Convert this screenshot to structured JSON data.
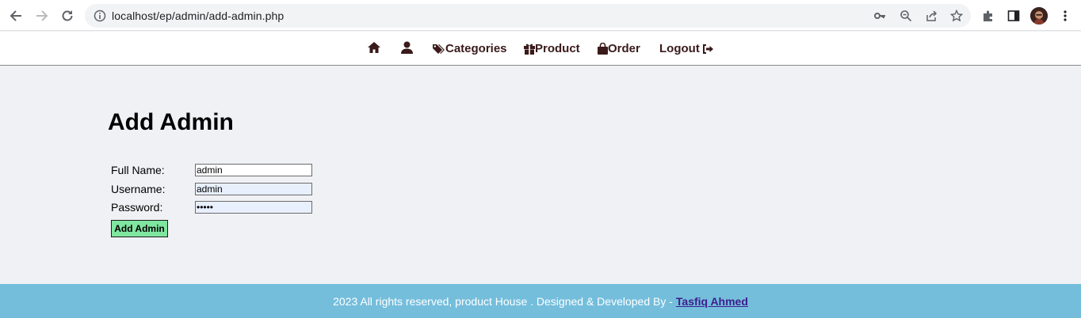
{
  "browser": {
    "url": "localhost/ep/admin/add-admin.php"
  },
  "nav": {
    "home_icon": "home-icon",
    "profile_icon": "user-icon",
    "categories": "Categories",
    "product": "Product",
    "order": "Order",
    "logout": "Logout"
  },
  "main": {
    "title": "Add Admin",
    "form": {
      "full_name_label": "Full Name:",
      "full_name_value": "admin",
      "username_label": "Username:",
      "username_value": "admin",
      "password_label": "Password:",
      "password_value": "•••••",
      "submit_label": "Add Admin"
    }
  },
  "footer": {
    "text": "2023 All rights reserved, product House . Designed & Developed By -",
    "author": "Tasfiq Ahmed"
  },
  "colors": {
    "nav_text": "#3a1a1a",
    "submit_bg": "#7fe6a0",
    "footer_bg": "#74bedc",
    "author_link": "#3d1d8c"
  }
}
